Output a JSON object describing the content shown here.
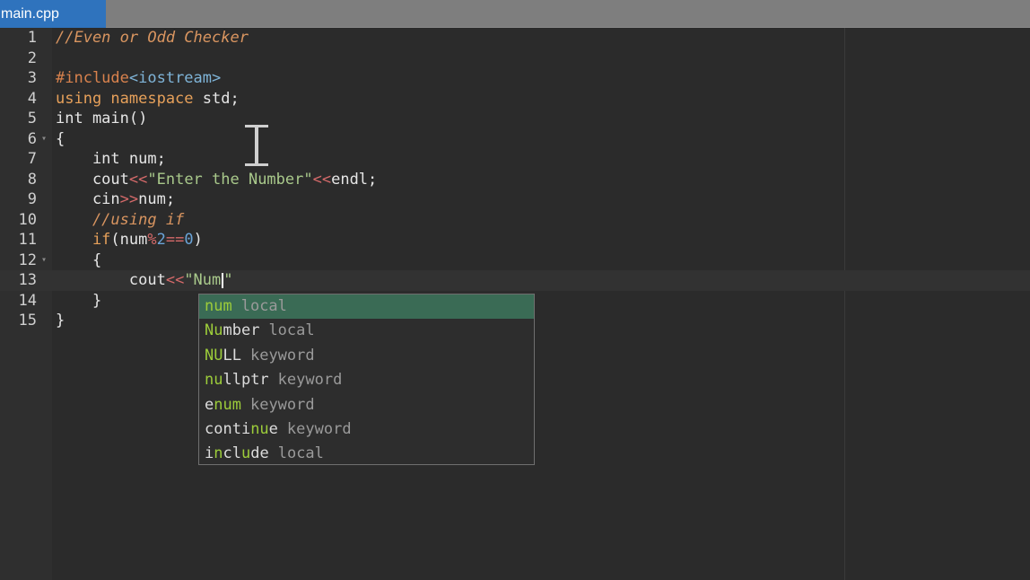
{
  "tab": {
    "label": "main.cpp"
  },
  "lines": [
    {
      "n": "1",
      "segs": [
        [
          "c-comment",
          "//Even or Odd Checker"
        ]
      ]
    },
    {
      "n": "2",
      "segs": []
    },
    {
      "n": "3",
      "segs": [
        [
          "c-pre",
          "#include"
        ],
        [
          "c-header",
          "<iostream>"
        ]
      ]
    },
    {
      "n": "4",
      "segs": [
        [
          "c-kw",
          "using namespace"
        ],
        [
          "",
          " std;"
        ]
      ]
    },
    {
      "n": "5",
      "segs": [
        [
          "",
          "int main()"
        ]
      ]
    },
    {
      "n": "6",
      "fold": "▾",
      "segs": [
        [
          "",
          "{"
        ]
      ]
    },
    {
      "n": "7",
      "segs": [
        [
          "",
          "    int num;"
        ]
      ]
    },
    {
      "n": "8",
      "segs": [
        [
          "",
          "    cout"
        ],
        [
          "c-op",
          "<<"
        ],
        [
          "c-str",
          "\"Enter the Number\""
        ],
        [
          "c-op",
          "<<"
        ],
        [
          "",
          "endl;"
        ]
      ]
    },
    {
      "n": "9",
      "segs": [
        [
          "",
          "    cin"
        ],
        [
          "c-op",
          ">>"
        ],
        [
          "",
          "num;"
        ]
      ]
    },
    {
      "n": "10",
      "segs": [
        [
          "c-comment",
          "    //using if"
        ]
      ]
    },
    {
      "n": "11",
      "segs": [
        [
          "c-kw",
          "    if"
        ],
        [
          "",
          "(num"
        ],
        [
          "c-op",
          "%"
        ],
        [
          "c-num",
          "2"
        ],
        [
          "c-op",
          "=="
        ],
        [
          "c-num",
          "0"
        ],
        [
          "",
          ")"
        ]
      ]
    },
    {
      "n": "12",
      "fold": "▾",
      "segs": [
        [
          "",
          "    {"
        ]
      ]
    },
    {
      "n": "13",
      "current": true,
      "segs": [
        [
          "",
          "        cout"
        ],
        [
          "c-op",
          "<<"
        ],
        [
          "c-str",
          "\"Num"
        ],
        [
          "caret",
          ""
        ],
        [
          "c-str",
          "\""
        ]
      ]
    },
    {
      "n": "14",
      "segs": [
        [
          "",
          "    }"
        ]
      ]
    },
    {
      "n": "15",
      "segs": [
        [
          "",
          "}"
        ]
      ]
    }
  ],
  "autocomplete": {
    "items": [
      {
        "parts": [
          [
            "hl",
            "num"
          ]
        ],
        "kind": "local",
        "selected": true
      },
      {
        "parts": [
          [
            "hl",
            "Nu"
          ],
          [
            "",
            "mber"
          ]
        ],
        "kind": "local"
      },
      {
        "parts": [
          [
            "hl",
            "NU"
          ],
          [
            "",
            "LL"
          ]
        ],
        "kind": "keyword"
      },
      {
        "parts": [
          [
            "hl",
            "nu"
          ],
          [
            "",
            "llptr"
          ]
        ],
        "kind": "keyword"
      },
      {
        "parts": [
          [
            "",
            "e"
          ],
          [
            "hl",
            "num"
          ]
        ],
        "kind": "keyword"
      },
      {
        "parts": [
          [
            "",
            "conti"
          ],
          [
            "hl",
            "nu"
          ],
          [
            "",
            "e"
          ]
        ],
        "kind": "keyword"
      },
      {
        "parts": [
          [
            "",
            "i"
          ],
          [
            "hl",
            "n"
          ],
          [
            "",
            "cl"
          ],
          [
            "hl",
            "u"
          ],
          [
            "",
            "de"
          ]
        ],
        "kind": "local"
      }
    ]
  },
  "colors": {
    "background": "#2b2b2b",
    "tab_active": "#2f73bd",
    "selection": "#3a6b55",
    "match": "#9ccc3a"
  }
}
